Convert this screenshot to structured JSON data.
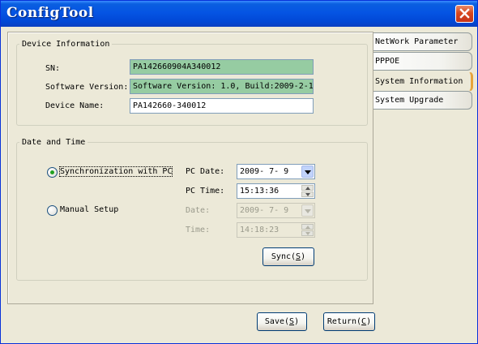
{
  "window": {
    "title": "ConfigTool"
  },
  "tabs": [
    {
      "label": "NetWork Parameter",
      "active": false
    },
    {
      "label": "PPPOE",
      "active": false
    },
    {
      "label": "System Information",
      "active": true
    },
    {
      "label": "System Upgrade",
      "active": false
    }
  ],
  "device_info": {
    "legend": "Device Information",
    "sn_label": "SN:",
    "sn_value": "PA142660904A340012",
    "software_label": "Software Version:",
    "software_value": "Software Version: 1.0, Build:2009-2-1",
    "name_label": "Device Name:",
    "name_value": "PA142660-340012"
  },
  "date_time": {
    "legend": "Date and Time",
    "sync_label": "Synchronization with PC",
    "sync_selected": true,
    "manual_label": "Manual Setup",
    "manual_selected": false,
    "pc_date_label": "PC Date:",
    "pc_date_value": "2009- 7- 9",
    "pc_time_label": "PC Time:",
    "pc_time_value": "15:13:36",
    "date_label": "Date:",
    "date_value": "2009- 7- 9",
    "time_label": "Time:",
    "time_value": "14:18:23",
    "sync_button_text": "Sync",
    "sync_button_key": "S"
  },
  "footer": {
    "save_text": "Save",
    "save_key": "S",
    "return_text": "Return",
    "return_key": "C"
  },
  "colors": {
    "titlebar": "#0554e3",
    "close_button": "#d8471e",
    "highlight_field": "#96cca2",
    "active_tab_marker": "#e6a43c"
  },
  "icons": {
    "close": "close-icon",
    "dropdown": "chevron-down-icon",
    "spin_up": "chevron-up-icon",
    "spin_down": "chevron-down-icon"
  }
}
